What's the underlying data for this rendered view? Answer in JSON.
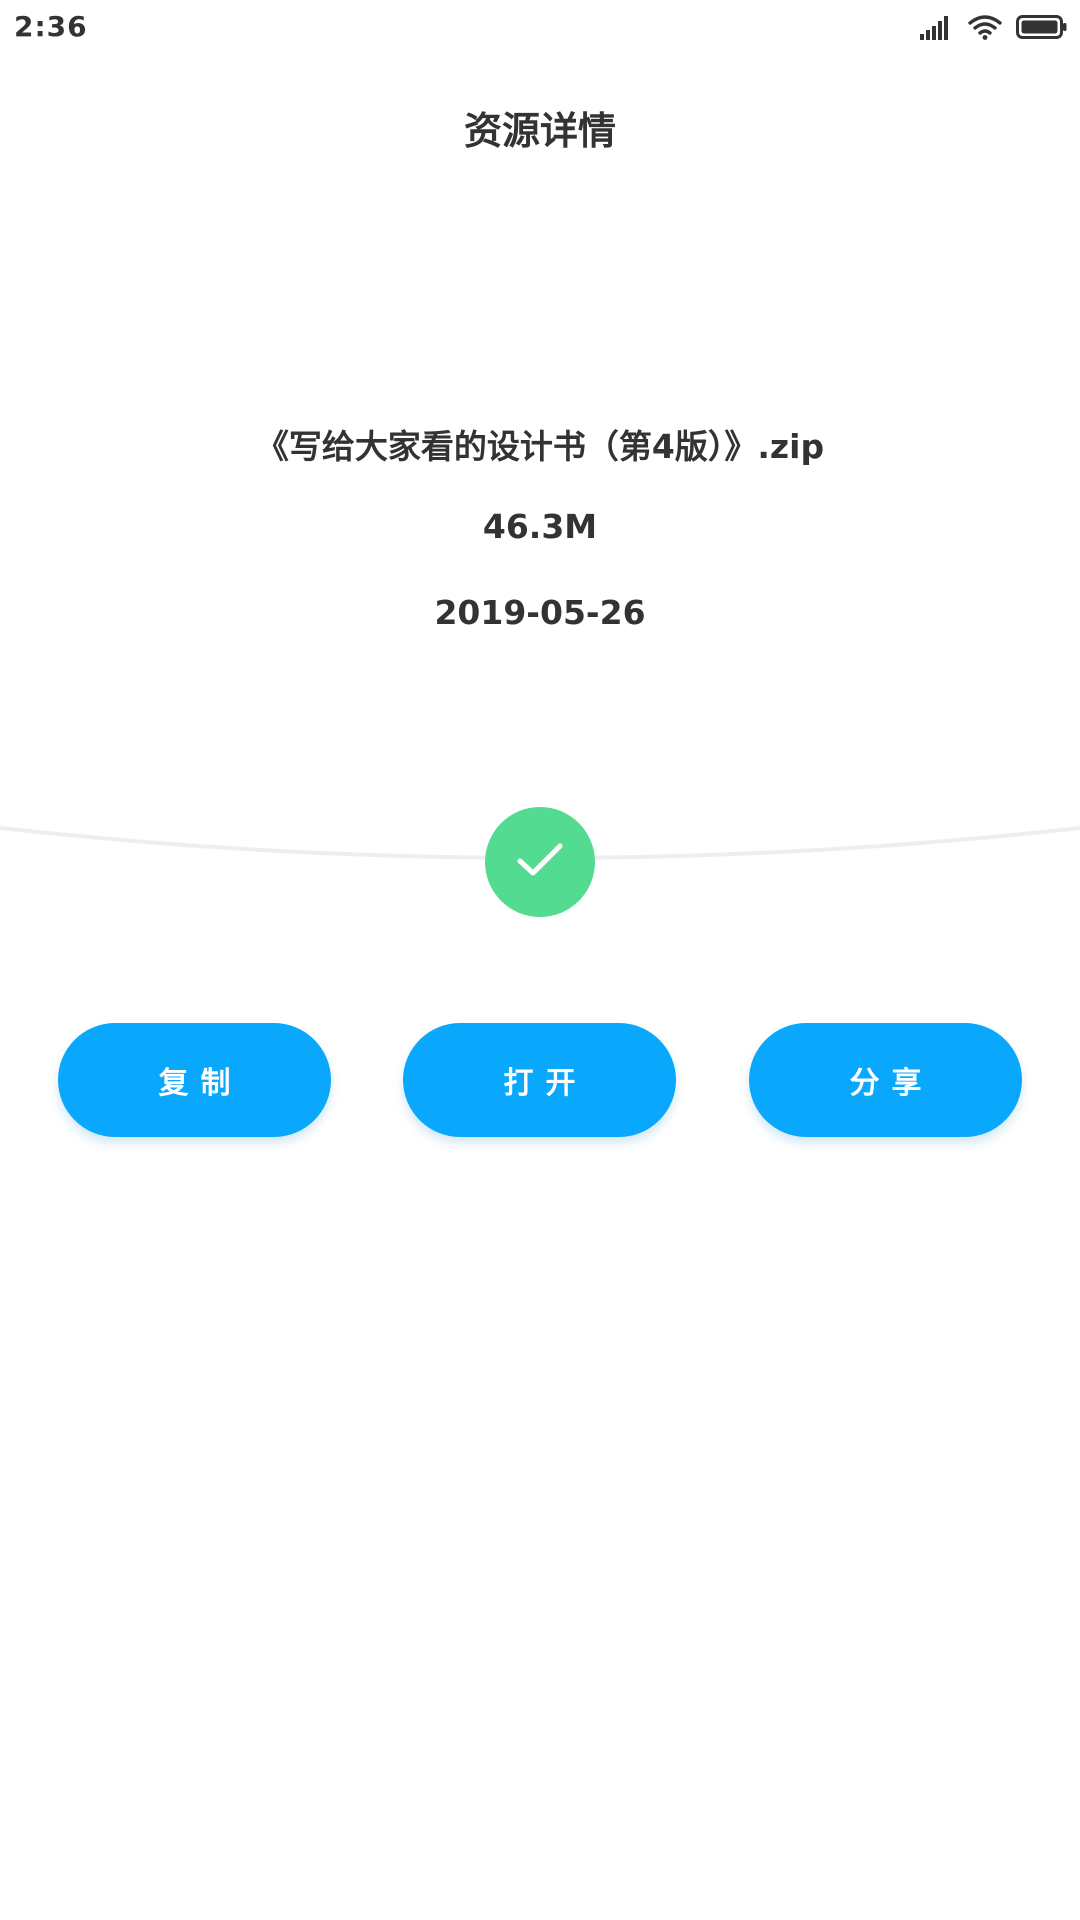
{
  "status_bar": {
    "time": "2:36",
    "icons": [
      "signal-icon",
      "wifi-icon",
      "battery-icon"
    ]
  },
  "header": {
    "title": "资源详情"
  },
  "resource": {
    "file_name": "《写给大家看的设计书（第4版）》.zip",
    "file_size": "46.3M",
    "date": "2019-05-26",
    "status_icon": "check-icon"
  },
  "actions": {
    "copy_label": "复制",
    "open_label": "打开",
    "share_label": "分享"
  },
  "colors": {
    "accent": "#09a8fd",
    "success": "#52db91",
    "text": "#333333",
    "curve": "#eeeeee"
  }
}
